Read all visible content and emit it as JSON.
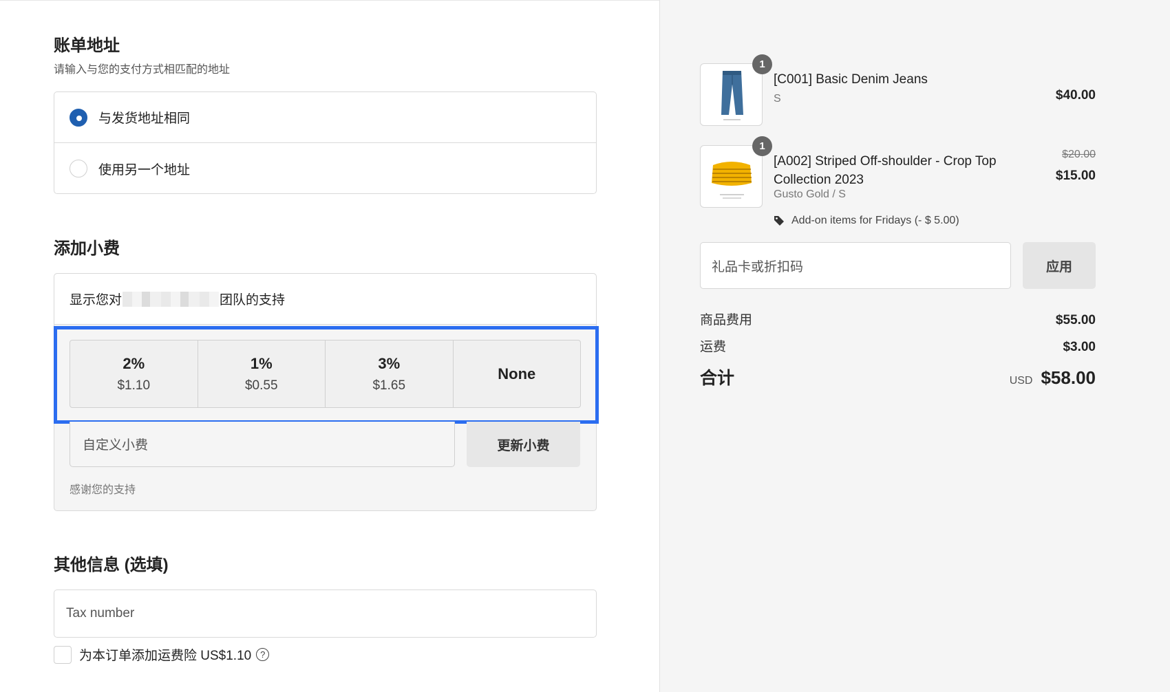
{
  "billing": {
    "title": "账单地址",
    "subtitle": "请输入与您的支付方式相匹配的地址",
    "options": [
      {
        "label": "与发货地址相同",
        "checked": true
      },
      {
        "label": "使用另一个地址",
        "checked": false
      }
    ]
  },
  "tip": {
    "title": "添加小费",
    "support_prefix": "显示您对",
    "support_suffix": "团队的支持",
    "options": [
      {
        "percent": "2%",
        "amount": "$1.10"
      },
      {
        "percent": "1%",
        "amount": "$0.55"
      },
      {
        "percent": "3%",
        "amount": "$1.65"
      }
    ],
    "none_label": "None",
    "custom_placeholder": "自定义小费",
    "update_label": "更新小费",
    "thanks": "感谢您的支持",
    "highlight_color": "#2b6df0"
  },
  "other": {
    "title": "其他信息 (选填)",
    "tax_placeholder": "Tax number",
    "insurance_label": "为本订单添加运费险 US$1.10",
    "help_icon": "?"
  },
  "cart": {
    "items": [
      {
        "quantity": "1",
        "name": "[C001] Basic Denim Jeans",
        "variant": "S",
        "price": "$40.00",
        "thumb_icon": "jeans-image"
      },
      {
        "quantity": "1",
        "name": "[A002] Striped Off-shoulder - Crop Top Collection 2023",
        "variant": "Gusto Gold / S",
        "old_price": "$20.00",
        "price": "$15.00",
        "discount": "Add-on items for Fridays (- $ 5.00)",
        "thumb_icon": "crop-top-image"
      }
    ],
    "gift_placeholder": "礼品卡或折扣码",
    "apply_label": "应用",
    "subtotal_label": "商品费用",
    "subtotal_value": "$55.00",
    "shipping_label": "运费",
    "shipping_value": "$3.00",
    "total_label": "合计",
    "currency": "USD",
    "total_value": "$58.00"
  }
}
